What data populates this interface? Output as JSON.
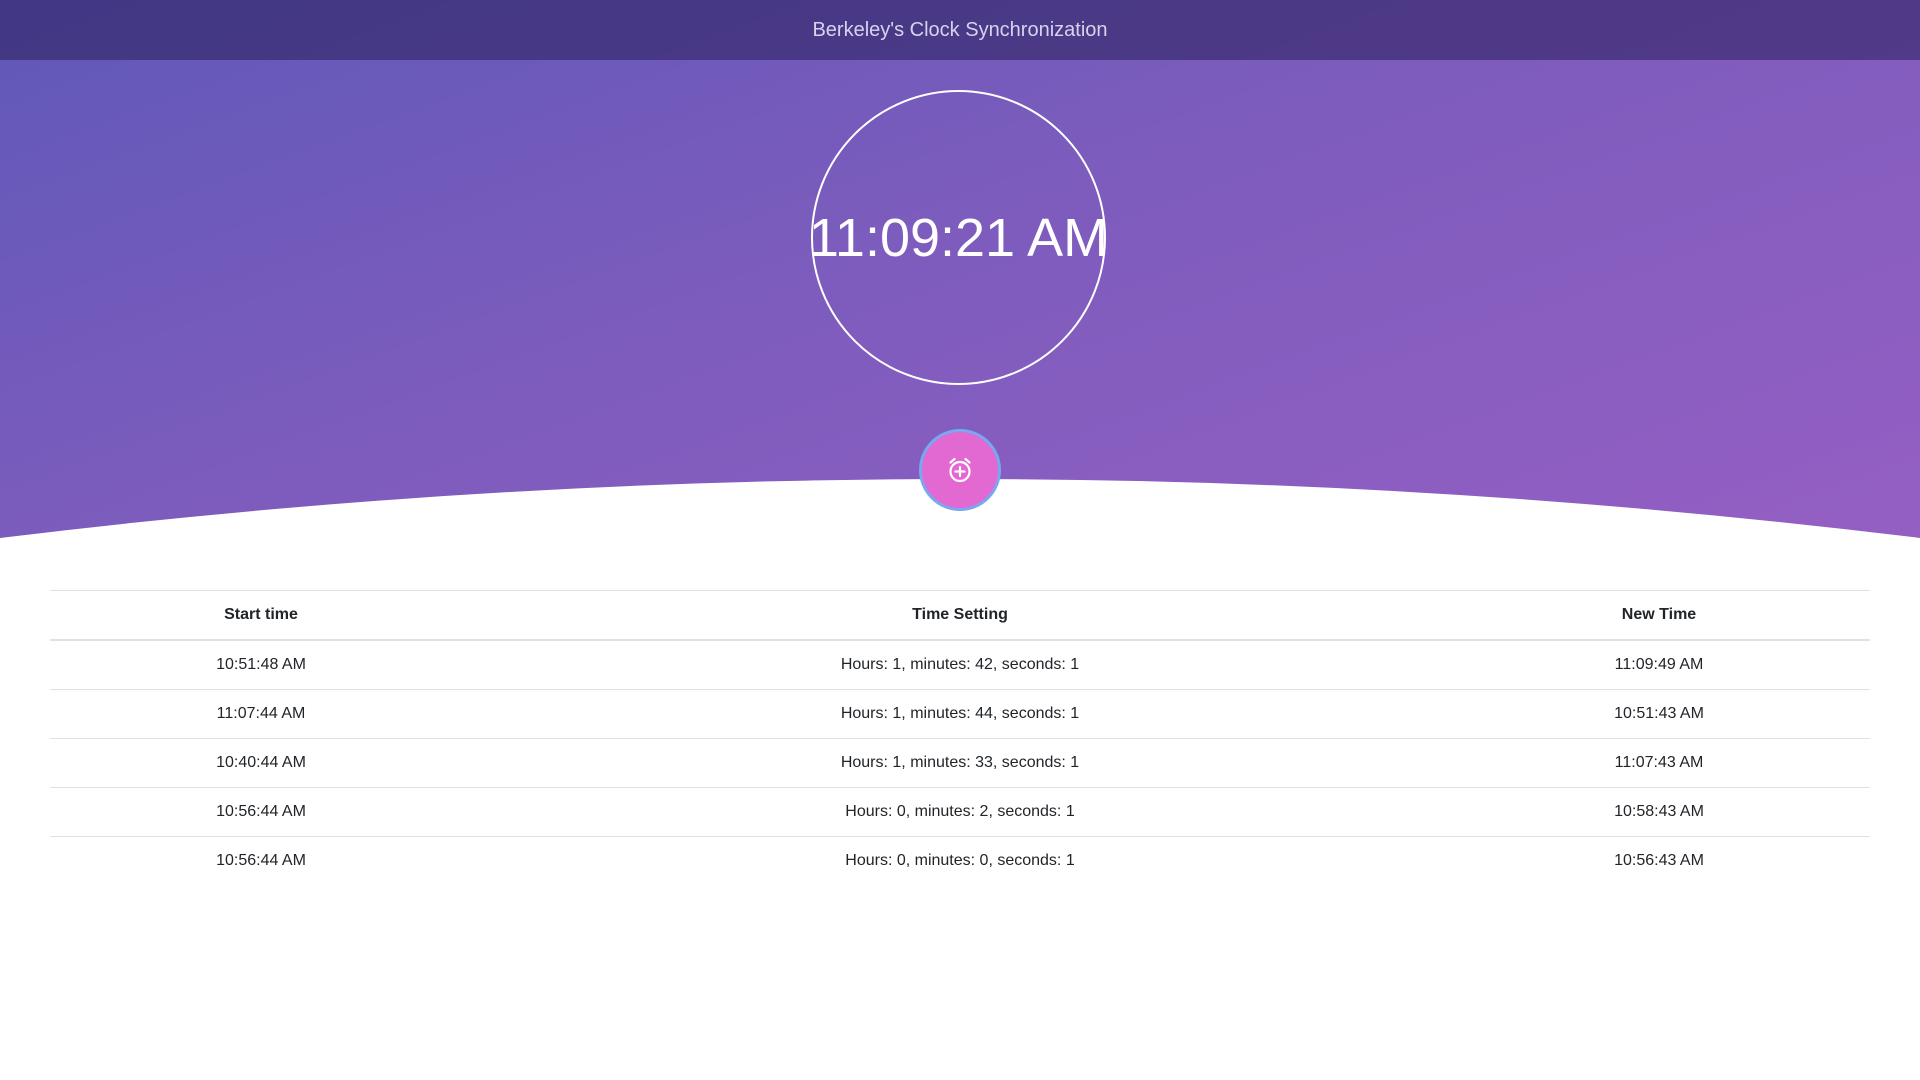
{
  "navbar": {
    "title": "Berkeley's Clock Synchronization"
  },
  "clock": {
    "time": "11:09:21 AM"
  },
  "add_button": {
    "icon": "alarm-plus-icon"
  },
  "table": {
    "headers": [
      "Start time",
      "Time Setting",
      "New Time"
    ],
    "rows": [
      [
        "10:51:48 AM",
        "Hours: 1, minutes: 42, seconds: 1",
        "11:09:49 AM"
      ],
      [
        "11:07:44 AM",
        "Hours: 1, minutes: 44, seconds: 1",
        "10:51:43 AM"
      ],
      [
        "10:40:44 AM",
        "Hours: 1, minutes: 33, seconds: 1",
        "11:07:43 AM"
      ],
      [
        "10:56:44 AM",
        "Hours: 0, minutes: 2, seconds: 1",
        "10:58:43 AM"
      ],
      [
        "10:56:44 AM",
        "Hours: 0, minutes: 0, seconds: 1",
        "10:56:43 AM"
      ]
    ]
  },
  "colors": {
    "gradient_start": "#5f58b8",
    "gradient_end": "#955fc3",
    "button_fill": "#e268d2",
    "button_border": "#7aa8f0"
  }
}
